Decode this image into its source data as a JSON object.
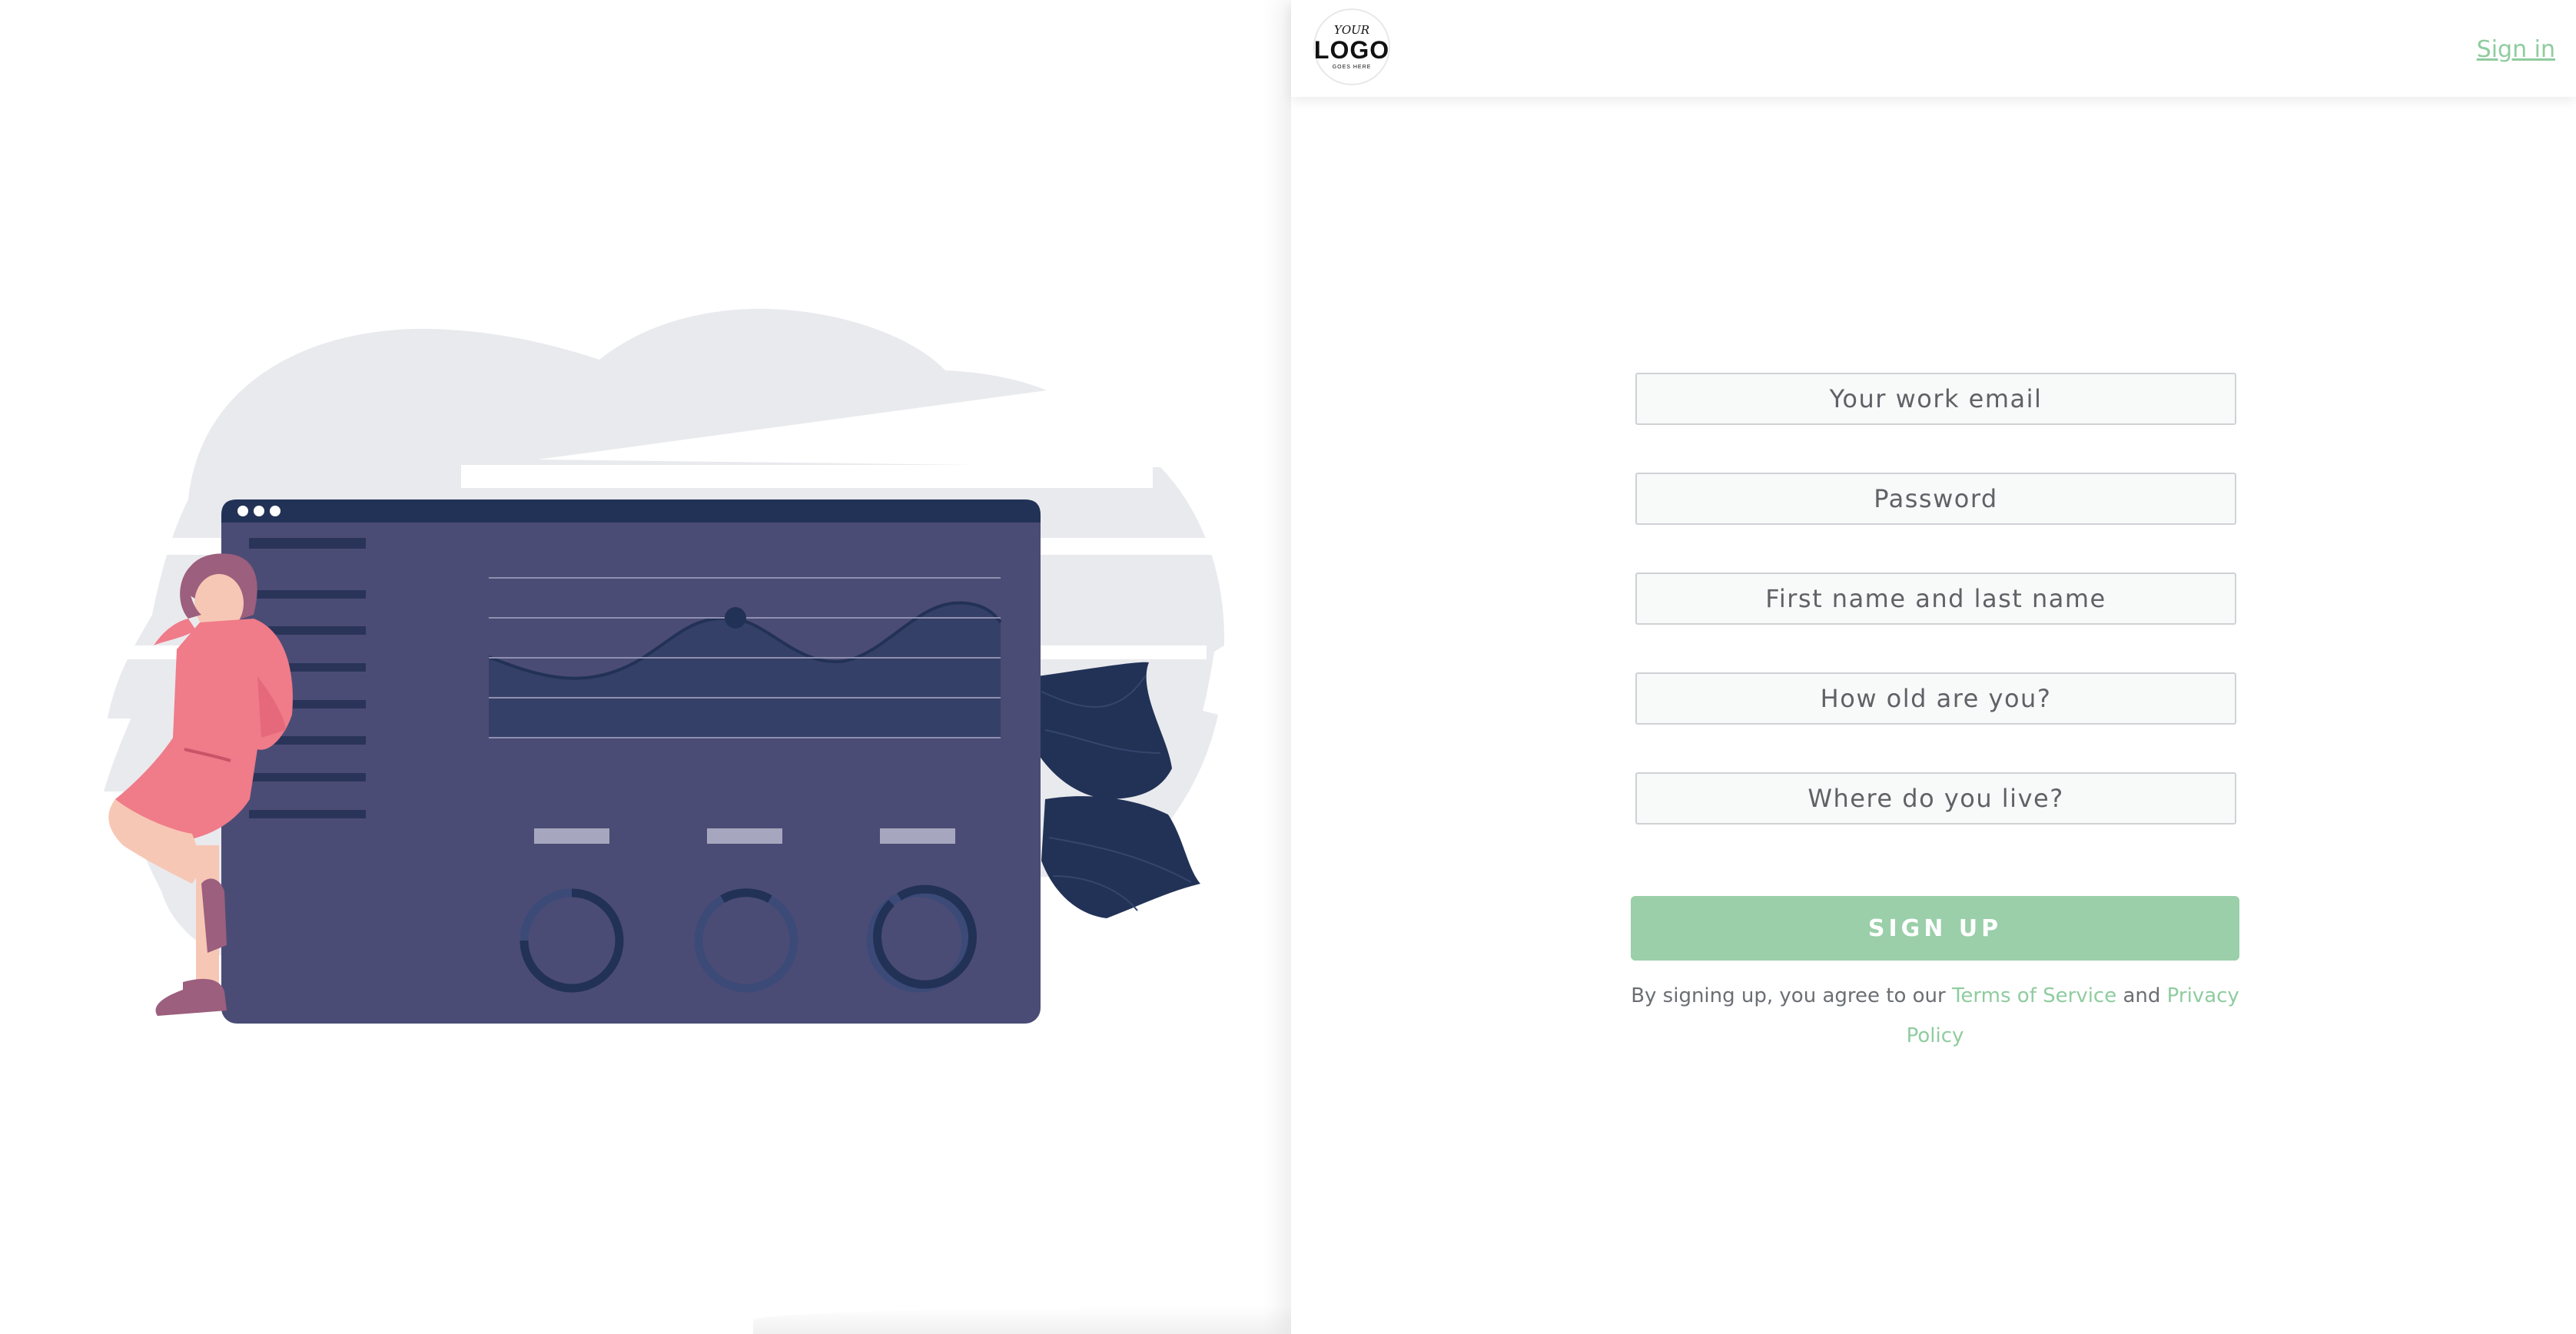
{
  "header": {
    "logo": {
      "line1": "YOUR",
      "line2": "LOGO",
      "line3": "GOES HERE"
    },
    "signin_label": "Sign in"
  },
  "form": {
    "email_placeholder": "Your work email",
    "password_placeholder": "Password",
    "name_placeholder": "First name and last name",
    "age_placeholder": "How old are you?",
    "location_placeholder": "Where do you live?",
    "submit_label": "SIGN UP"
  },
  "terms": {
    "prefix": "By signing up, you agree to our ",
    "terms_link": "Terms of Service",
    "middle": " and ",
    "privacy_link": "Privacy Policy"
  },
  "colors": {
    "accent": "#8fcc9f",
    "button": "#9acfa9",
    "dashboard": "#4b4c75",
    "dashboard_dark": "#223256",
    "figure": "#f07b89"
  }
}
